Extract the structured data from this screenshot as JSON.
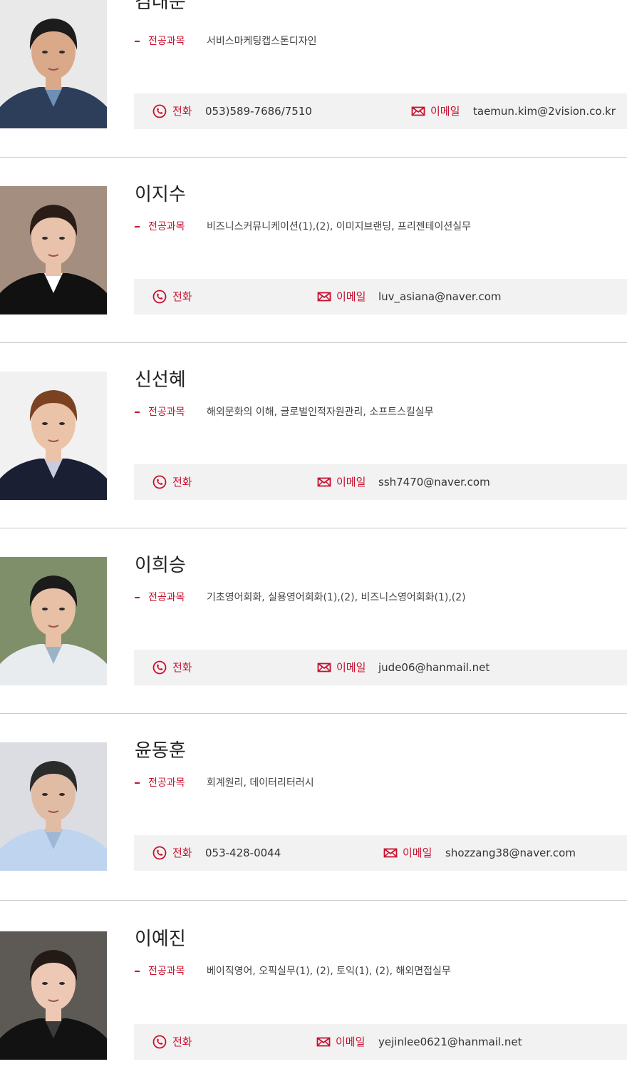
{
  "labels": {
    "major": "전공과목",
    "phone": "전화",
    "email": "이메일"
  },
  "colors": {
    "accent": "#c8102e",
    "contact_bg": "#f2f2f2",
    "divider": "#cccccc"
  },
  "icons": {
    "phone": "phone-icon",
    "email": "mail-icon",
    "bullet": "dash-bullet"
  },
  "people": [
    {
      "name": "김태문",
      "major": "서비스마케팅캡스톤디자인",
      "phone": "053)589-7686/7510",
      "email": "taemun.kim@2vision.co.kr"
    },
    {
      "name": "이지수",
      "major": "비즈니스커뮤니케이션(1),(2), 이미지브랜딩, 프리젠테이션실무",
      "phone": "",
      "email": "luv_asiana@naver.com"
    },
    {
      "name": "신선혜",
      "major": "해외문화의 이해, 글로벌인적자원관리, 소프트스킬실무",
      "phone": "",
      "email": "ssh7470@naver.com"
    },
    {
      "name": "이희승",
      "major": "기초영어회화, 실용영어회화(1),(2), 비즈니스영어회화(1),(2)",
      "phone": "",
      "email": "jude06@hanmail.net"
    },
    {
      "name": "윤동훈",
      "major": "회계원리, 데이터리터러시",
      "phone": "053-428-0044",
      "email": "shozzang38@naver.com"
    },
    {
      "name": "이예진",
      "major": "베이직영어, 오픽실무(1), (2), 토익(1), (2), 해외면접실무",
      "phone": "",
      "email": "yejinlee0621@hanmail.net"
    }
  ]
}
